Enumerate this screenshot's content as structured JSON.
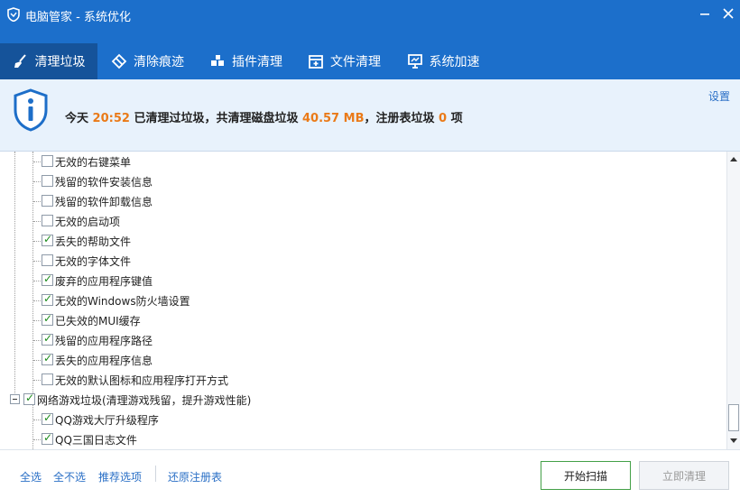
{
  "window": {
    "title": "电脑管家 - 系统优化",
    "logo_icon": "shield-logo-icon",
    "minimize_icon": "minimize-icon",
    "close_icon": "close-icon"
  },
  "tabs": [
    {
      "label": "清理垃圾",
      "icon": "broom-icon",
      "active": true
    },
    {
      "label": "清除痕迹",
      "icon": "eraser-icon",
      "active": false
    },
    {
      "label": "插件清理",
      "icon": "puzzle-icon",
      "active": false
    },
    {
      "label": "文件清理",
      "icon": "file-box-icon",
      "active": false
    },
    {
      "label": "系统加速",
      "icon": "monitor-icon",
      "active": false
    }
  ],
  "summary": {
    "part1": "今天 ",
    "time": "20:52",
    "part2": " 已清理过垃圾，共清理磁盘垃圾 ",
    "disk_size": "40.57 MB",
    "part3": "，注册表垃圾 ",
    "registry_count": "0",
    "part4": " 项",
    "settings_label": "设置",
    "accent_color": "#ea7a18"
  },
  "tree": {
    "items": [
      {
        "label": "无效的右键菜单",
        "checked": false
      },
      {
        "label": "残留的软件安装信息",
        "checked": false
      },
      {
        "label": "残留的软件卸载信息",
        "checked": false
      },
      {
        "label": "无效的启动项",
        "checked": false
      },
      {
        "label": "丢失的帮助文件",
        "checked": true
      },
      {
        "label": "无效的字体文件",
        "checked": false
      },
      {
        "label": "废弃的应用程序键值",
        "checked": true
      },
      {
        "label": "无效的Windows防火墙设置",
        "checked": true
      },
      {
        "label": "已失效的MUI缓存",
        "checked": true
      },
      {
        "label": "残留的应用程序路径",
        "checked": true
      },
      {
        "label": "丢失的应用程序信息",
        "checked": true
      },
      {
        "label": "无效的默认图标和应用程序打开方式",
        "checked": false
      }
    ],
    "group": {
      "label": "网络游戏垃圾(清理游戏残留，提升游戏性能)",
      "checked": true
    },
    "group_items": [
      {
        "label": "QQ游戏大厅升级程序",
        "checked": true
      },
      {
        "label": "QQ三国日志文件",
        "checked": true
      }
    ]
  },
  "footer": {
    "select_all": "全选",
    "select_none": "全不选",
    "recommended": "推荐选项",
    "restore_registry": "还原注册表",
    "scan_button": "开始扫描",
    "clean_button": "立即清理"
  }
}
